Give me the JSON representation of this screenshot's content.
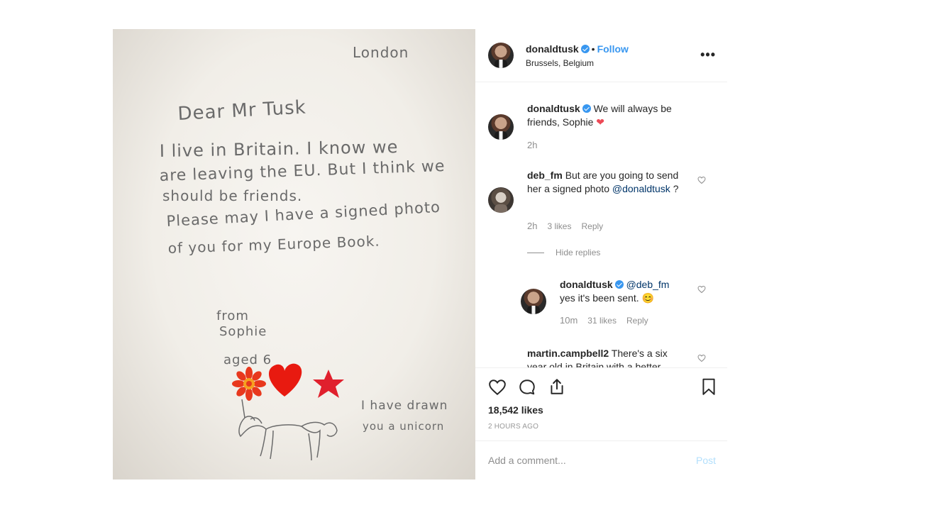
{
  "post": {
    "author": "donaldtusk",
    "follow_label": "Follow",
    "location": "Brussels, Belgium",
    "more_label": "•••",
    "likes": "18,542 likes",
    "time": "2 HOURS AGO"
  },
  "letter": {
    "city": "London",
    "greeting": "Dear Mr Tusk",
    "line1": "I live in Britain. I know we",
    "line2": "are leaving the EU. But I think we",
    "line3": "should be friends.",
    "line4": "Please may I have a signed photo",
    "line5": "of you for my Europe Book.",
    "from": "from",
    "name": "Sophie",
    "age": "aged 6",
    "note1": "I have drawn",
    "note2": "you a unicorn"
  },
  "comments": [
    {
      "user": "donaldtusk",
      "text": "We will always be friends, Sophie",
      "emoji": "❤",
      "time": "2h"
    },
    {
      "user": "deb_fm",
      "text": "But are you going to send her a signed photo",
      "mention": "@donaldtusk",
      "suffix": " ?",
      "time": "2h",
      "likes": "3 likes",
      "reply": "Reply",
      "hide_replies": "Hide replies"
    },
    {
      "user": "donaldtusk",
      "mention": "@deb_fm",
      "text": "yes it's been sent.",
      "emoji": "😊",
      "time": "10m",
      "likes": "31 likes",
      "reply": "Reply"
    },
    {
      "user": "martin.campbell2",
      "text": "There's a six year old in Britain with a better"
    }
  ],
  "add_comment": {
    "placeholder": "Add a comment...",
    "post_label": "Post"
  },
  "icons": [
    "heart-icon",
    "comment-icon",
    "share-icon",
    "bookmark-icon",
    "verified-icon",
    "more-icon"
  ],
  "colors": {
    "link": "#3897f0",
    "mention": "#003569",
    "muted": "#8e8e8e",
    "heart": "#ed4956"
  }
}
